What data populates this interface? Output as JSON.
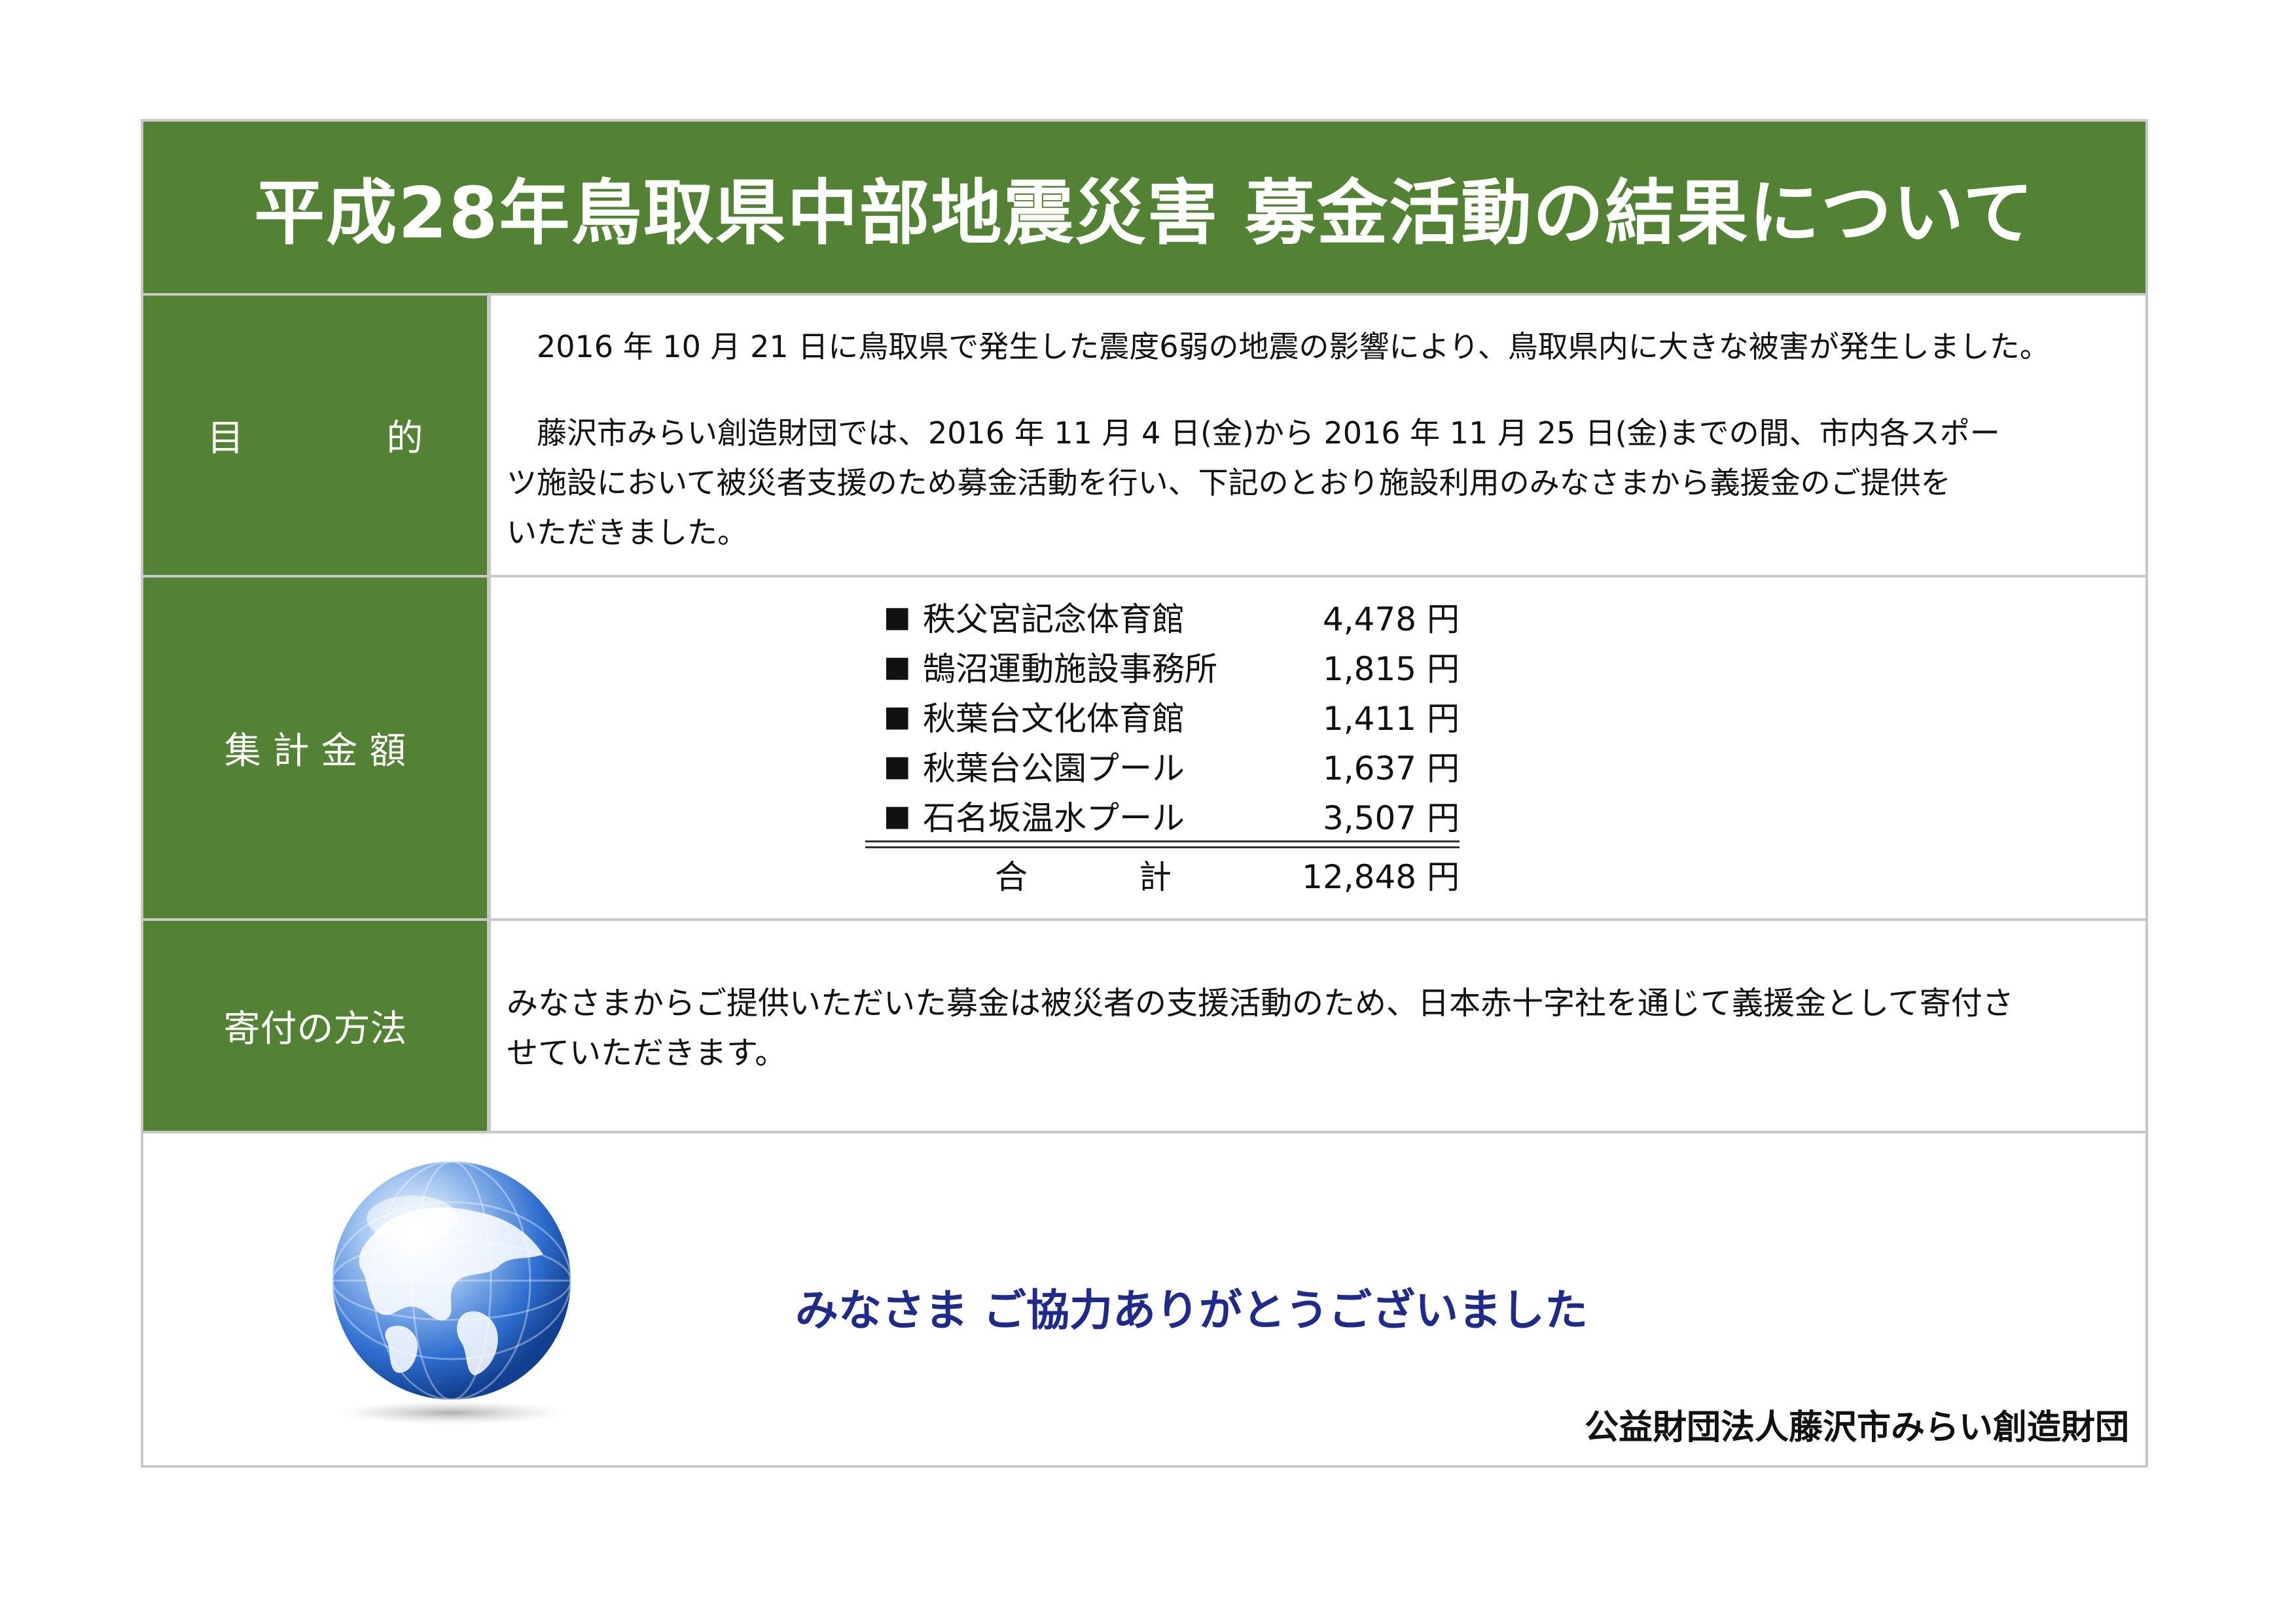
{
  "title": "平成28年鳥取県中部地震災害  募金活動の結果について",
  "purpose": {
    "label_left": "目",
    "label_right": "的",
    "para1": "2016 年 10 月 21 日に鳥取県で発生した震度6弱の地震の影響により、鳥取県内に大きな被害が発生しました。",
    "para2_line1": "藤沢市みらい創造財団では、2016 年 11 月 4 日(金)から 2016 年 11 月 25 日(金)までの間、市内各スポー",
    "para2_line2": "ツ施設において被災者支援のため募金活動を行い、下記のとおり施設利用のみなさまから義援金のご提供を",
    "para2_line3": "いただきました。"
  },
  "totals": {
    "label": "集 計 金 額",
    "bullet": "■",
    "rows": [
      {
        "venue": "秩父宮記念体育館",
        "amount": "4,478 円"
      },
      {
        "venue": "鵠沼運動施設事務所",
        "amount": "1,815 円"
      },
      {
        "venue": "秋葉台文化体育館",
        "amount": "1,411 円"
      },
      {
        "venue": "秋葉台公園プール",
        "amount": "1,637 円"
      },
      {
        "venue": "石名坂温水プール",
        "amount": "3,507 円"
      }
    ],
    "sum_label_left": "合",
    "sum_label_right": "計",
    "sum_amount": "12,848 円"
  },
  "method": {
    "label": "寄付の方法",
    "line1": "みなさまからご提供いただいた募金は被災者の支援活動のため、日本赤十字社を通じて義援金として寄付さ",
    "line2": "せていただきます。"
  },
  "footer": {
    "thanks": "みなさま   ご協力ありがとうございました",
    "organization": "公益財団法人藤沢市みらい創造財団",
    "globe_icon": "globe-icon"
  },
  "colors": {
    "header_green": "#548235",
    "thanks_blue": "#1f2a8c"
  }
}
